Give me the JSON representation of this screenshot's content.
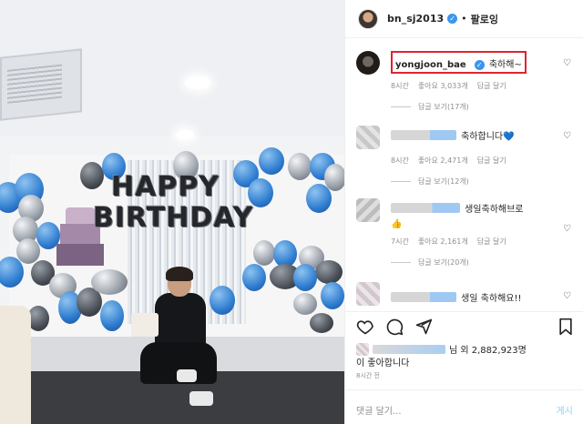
{
  "photo": {
    "banner": {
      "line1": "HAPPY",
      "line2": "BIRTHDAY"
    }
  },
  "header": {
    "username": "bn_sj2013",
    "separator": "•",
    "follow_label": "팔로잉",
    "verified_icon": "verified-badge-icon"
  },
  "comments": [
    {
      "name": "yongjoon_bae",
      "text": "축하해~",
      "time": "8시간",
      "likes": "좋아요 3,033개",
      "reply_label": "답글 달기",
      "replies": "답글 보기(17개)",
      "highlighted": true
    },
    {
      "name": "",
      "text": "축하합니다💙",
      "time": "8시간",
      "likes": "좋아요 2,471개",
      "reply_label": "답글 달기",
      "replies": "답글 보기(12개)"
    },
    {
      "name": "",
      "text": "생일축하해브로",
      "emoji": "👍",
      "time": "7시간",
      "likes": "좋아요 2,161개",
      "reply_label": "답글 달기",
      "replies": "답글 보기(20개)"
    },
    {
      "name": "",
      "text": "생일 축하해요!!"
    }
  ],
  "actions": {
    "like_icon": "heart-icon",
    "comment_icon": "comment-icon",
    "share_icon": "share-icon",
    "save_icon": "bookmark-icon"
  },
  "likes": {
    "suffix": "님 외 2,882,923명",
    "line2": "이 좋아합니다",
    "time": "8시간 전"
  },
  "comment_input": {
    "placeholder": "댓글 달기...",
    "post_label": "게시"
  },
  "colors": {
    "highlight_border": "#e0242f",
    "verified": "#3897f0",
    "muted_text": "#8e8e8e",
    "post_disabled": "#b2dffc"
  }
}
